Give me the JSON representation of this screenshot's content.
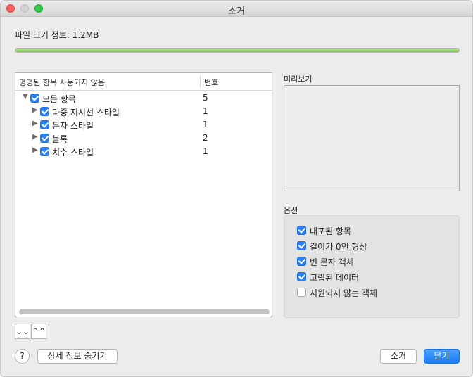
{
  "window": {
    "title": "소거"
  },
  "file_info": "파일 크기 정보: 1.2MB",
  "progress": {
    "fraction": 1.0
  },
  "tree": {
    "header_name": "명명된 항목 사용되지 않음",
    "header_count": "번호",
    "rows": [
      {
        "label": "모든 항목",
        "count": "5",
        "checked": true,
        "expanded": true,
        "indent": 0
      },
      {
        "label": "다중 지시선 스타일",
        "count": "1",
        "checked": true,
        "expanded": false,
        "indent": 1
      },
      {
        "label": "문자 스타일",
        "count": "1",
        "checked": true,
        "expanded": false,
        "indent": 1
      },
      {
        "label": "블록",
        "count": "2",
        "checked": true,
        "expanded": false,
        "indent": 1
      },
      {
        "label": "치수 스타일",
        "count": "1",
        "checked": true,
        "expanded": false,
        "indent": 1
      }
    ]
  },
  "preview_label": "미리보기",
  "options": {
    "label": "옵션",
    "items": [
      {
        "label": "내포된 항목",
        "checked": true
      },
      {
        "label": "길이가 0인 형상",
        "checked": true
      },
      {
        "label": "빈 문자 객체",
        "checked": true
      },
      {
        "label": "고립된 데이터",
        "checked": true
      },
      {
        "label": "지원되지 않는 객체",
        "checked": false
      }
    ]
  },
  "buttons": {
    "expand_all_glyph": "⌄⌄",
    "collapse_all_glyph": "⌃⌃",
    "help": "?",
    "hide_details": "상세 정보 숨기기",
    "purge": "소거",
    "close": "닫기"
  },
  "colors": {
    "accent": "#2b80f5",
    "progress": "#8bd65a"
  },
  "icons": [
    "expand-all-icon",
    "collapse-all-icon",
    "disclosure-triangle-icon",
    "help-icon"
  ]
}
